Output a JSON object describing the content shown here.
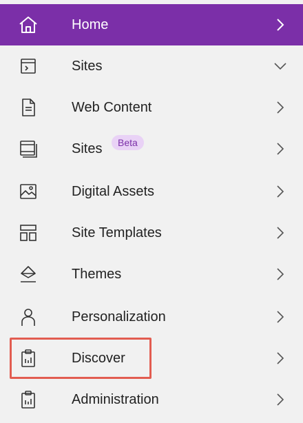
{
  "menu": {
    "items": [
      {
        "label": "Home",
        "icon": "home-icon",
        "chevron": "right"
      },
      {
        "label": "Sites",
        "icon": "site-console-icon",
        "chevron": "down"
      },
      {
        "label": "Web Content",
        "icon": "document-icon",
        "chevron": "right"
      },
      {
        "label": "Sites",
        "icon": "stacked-pages-icon",
        "chevron": "right",
        "badge": "Beta"
      },
      {
        "label": "Digital Assets",
        "icon": "image-icon",
        "chevron": "right"
      },
      {
        "label": "Site Templates",
        "icon": "layout-template-icon",
        "chevron": "right"
      },
      {
        "label": "Themes",
        "icon": "paint-bucket-icon",
        "chevron": "right"
      },
      {
        "label": "Personalization",
        "icon": "user-icon",
        "chevron": "right"
      },
      {
        "label": "Discover",
        "icon": "clipboard-chart-icon",
        "chevron": "right",
        "highlighted": true
      },
      {
        "label": "Administration",
        "icon": "clipboard-chart-icon",
        "chevron": "right"
      }
    ]
  },
  "colors": {
    "active_background": "#7b2fa8",
    "badge_background": "#e9d2f6",
    "highlight_border": "#e25c50"
  }
}
